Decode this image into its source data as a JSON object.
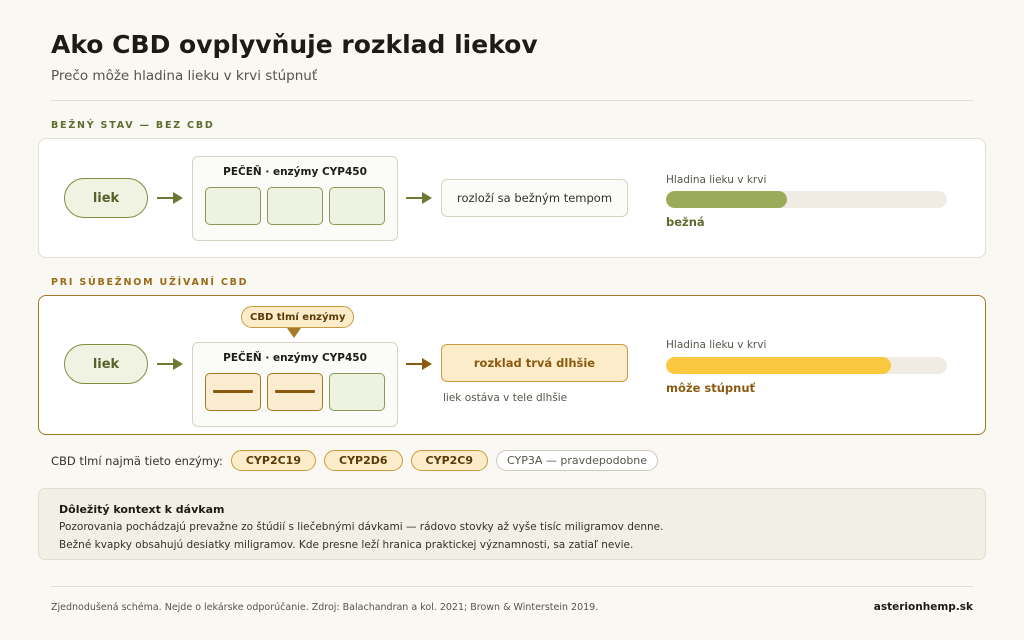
{
  "header": {
    "title": "Ako CBD ovplyvňuje rozklad liekov",
    "subtitle": "Prečo môže hladina lieku v krvi stúpnuť"
  },
  "colors": {
    "olive": "#7f8e45",
    "amber": "#c99a40",
    "normal_fill": "#9aab5a",
    "raised_fill": "#fbc93f"
  },
  "normal": {
    "section_label": "BEŽNÝ STAV — BEZ CBD",
    "drug_label": "liek",
    "liver_title": "PEČEŇ · enzýmy CYP450",
    "result": "rozloží sa bežným tempom",
    "level_label": "Hladina lieku v krvi",
    "level_value": "bežná",
    "level_fraction": 0.43
  },
  "cbd": {
    "section_label": "PRI SÚBEŽNOM UŽÍVANÍ CBD",
    "callout": "CBD tlmí enzýmy",
    "drug_label": "liek",
    "liver_title": "PEČEŇ · enzýmy CYP450",
    "result": "rozklad trvá dlhšie",
    "result_note": "liek ostáva v tele dlhšie",
    "level_label": "Hladina lieku v krvi",
    "level_value": "môže stúpnuť",
    "level_fraction": 0.8
  },
  "enzymes": {
    "label": "CBD tlmí najmä tieto enzýmy:",
    "strong": [
      "CYP2C19",
      "CYP2D6",
      "CYP2C9"
    ],
    "weak": "CYP3A — pravdepodobne"
  },
  "context": {
    "title": "Dôležitý kontext k dávkam",
    "line1": "Pozorovania pochádzajú prevažne zo štúdií s liečebnými dávkami — rádovo stovky až vyše tisíc miligramov denne.",
    "line2": "Bežné kvapky obsahujú desiatky miligramov. Kde presne leží hranica praktickej významnosti, sa zatiaľ nevie."
  },
  "footer": {
    "note": "Zjednodušená schéma. Nejde o lekárske odporúčanie. Zdroj: Balachandran a kol. 2021; Brown & Winterstein 2019.",
    "brand": "asterionhemp.sk"
  }
}
